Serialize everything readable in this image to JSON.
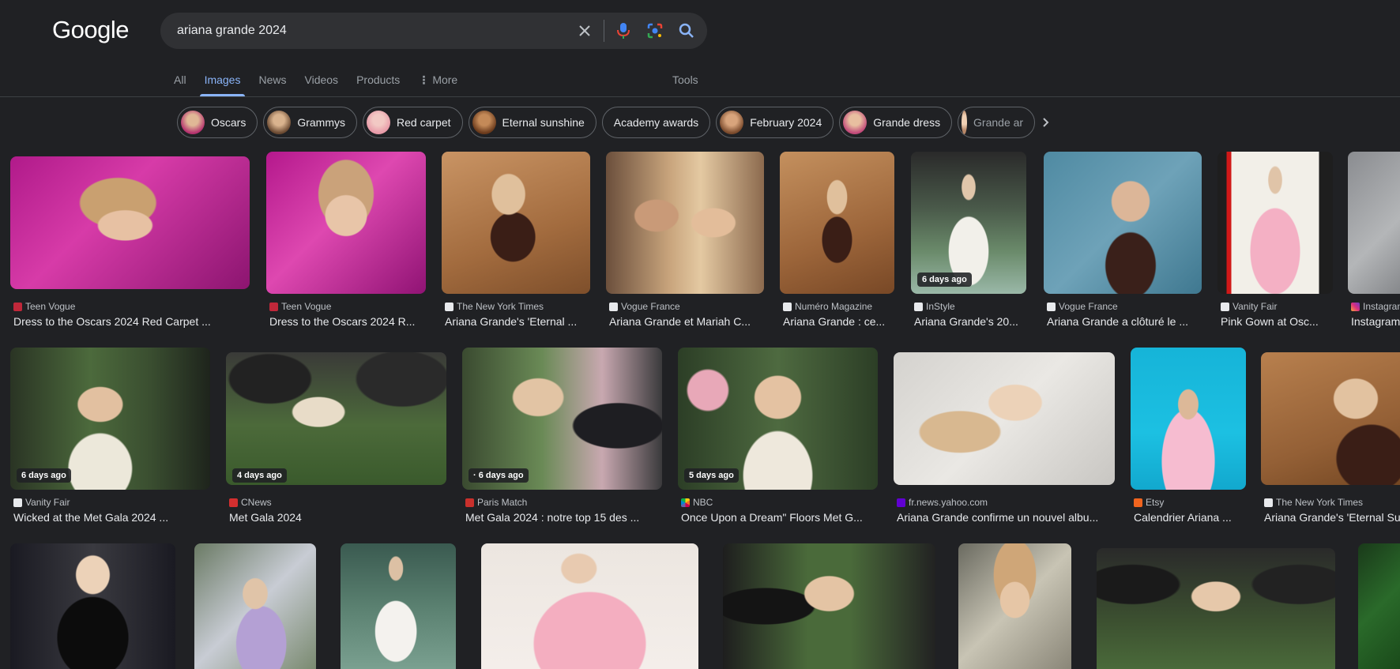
{
  "logo": "Google",
  "search": {
    "query": "ariana grande 2024"
  },
  "tabs": [
    "All",
    "Images",
    "News",
    "Videos",
    "Products",
    "More"
  ],
  "tools": "Tools",
  "chips": [
    "Oscars",
    "Grammys",
    "Red carpet",
    "Eternal sunshine",
    "Academy awards",
    "February 2024",
    "Grande dress",
    "Grande ar"
  ],
  "row1": [
    {
      "source": "Teen Vogue",
      "title": "Dress to the Oscars 2024 Red Carpet ..."
    },
    {
      "source": "Teen Vogue",
      "title": "Dress to the Oscars 2024 R..."
    },
    {
      "source": "The New York Times",
      "title": "Ariana Grande's 'Eternal ..."
    },
    {
      "source": "Vogue France",
      "title": "Ariana Grande et Mariah C..."
    },
    {
      "source": "Numéro Magazine",
      "title": "Ariana Grande : ce..."
    },
    {
      "source": "InStyle",
      "title": "Ariana Grande's 20...",
      "age": "6 days ago"
    },
    {
      "source": "Vogue France",
      "title": "Ariana Grande a clôturé le ..."
    },
    {
      "source": "Vanity Fair",
      "title": "Pink Gown at Osc..."
    },
    {
      "source": "Instagram",
      "title": "Instagram"
    }
  ],
  "row2": [
    {
      "source": "Vanity Fair",
      "title": "Wicked at the Met Gala 2024 ...",
      "age": "6 days ago"
    },
    {
      "source": "CNews",
      "title": "Met Gala 2024",
      "age": "4 days ago"
    },
    {
      "source": "Paris Match",
      "title": "Met Gala 2024 : notre top 15 des ...",
      "age": "· 6 days ago"
    },
    {
      "source": "NBC",
      "title": "Once Upon a Dream\" Floors Met G...",
      "age": "5 days ago"
    },
    {
      "source": "fr.news.yahoo.com",
      "title": "Ariana Grande confirme un nouvel albu..."
    },
    {
      "source": "Etsy",
      "title": "Calendrier Ariana ..."
    },
    {
      "source": "The New York Times",
      "title": "Ariana Grande's 'Eternal Su"
    }
  ]
}
